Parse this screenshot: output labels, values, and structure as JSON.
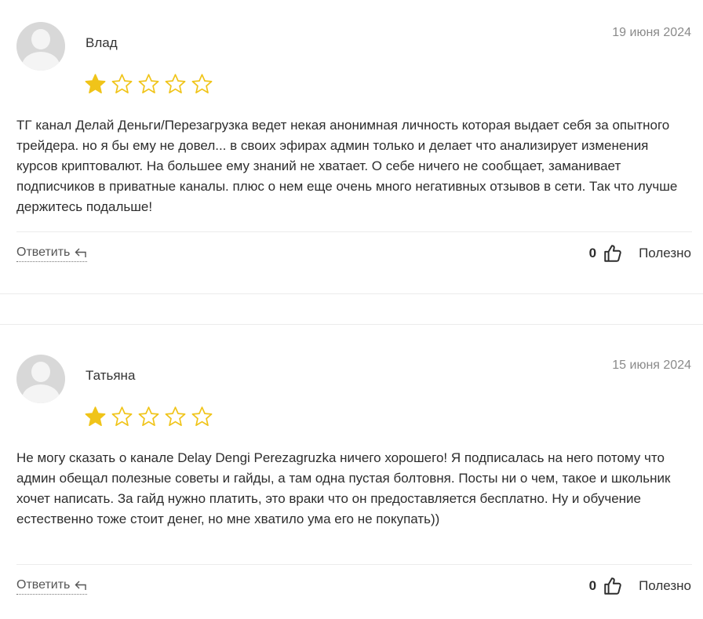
{
  "colors": {
    "star_filled": "#f0c419",
    "star_outline": "#f0c419",
    "divider": "#ececec"
  },
  "icons": {
    "avatar": "user-placeholder-icon",
    "reply": "reply-arrow-icon",
    "thumb": "thumbs-up-icon",
    "star": "star-icon"
  },
  "reviews": [
    {
      "author": "Влад",
      "date": "19 июня 2024",
      "rating": 1,
      "rating_max": 5,
      "text": "ТГ канал Делай Деньги/Перезагрузка ведет некая анонимная личность которая выдает себя за опытного трейдера. но я бы ему не довел... в своих эфирах админ только и делает что анализирует изменения курсов криптовалют. На большее ему знаний не хватает. О себе ничего не сообщает, заманивает подписчиков в приватные каналы. плюс о нем еще очень много негативных отзывов в сети. Так что лучше держитесь подальше!",
      "reply_label": "Ответить",
      "helpful_count": "0",
      "helpful_label": "Полезно"
    },
    {
      "author": "Татьяна",
      "date": "15 июня 2024",
      "rating": 1,
      "rating_max": 5,
      "text": "Не могу сказать о канале Delay Dengi Perezagruzka ничего хорошего! Я подписалась на него потому что админ обещал полезные советы и гайды, а там одна пустая болтовня. Посты ни о чем, такое и школьник хочет написать. За гайд нужно платить, это враки что он предоставляется бесплатно. Ну и обучение естественно тоже стоит денег, но мне хватило ума его не покупать))",
      "reply_label": "Ответить",
      "helpful_count": "0",
      "helpful_label": "Полезно"
    }
  ]
}
